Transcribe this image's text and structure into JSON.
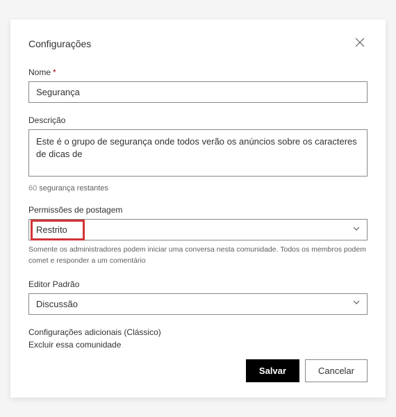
{
  "dialog": {
    "title": "Configurações"
  },
  "fields": {
    "name": {
      "label": "Nome",
      "required_marker": "*",
      "value": "Segurança"
    },
    "description": {
      "label": "Descrição",
      "value": "Este é o grupo de segurança onde todos verão os anúncios sobre os caracteres de dicas de",
      "counter_count": "60",
      "counter_text": "segurança restantes"
    },
    "permissions": {
      "label": "Permissões de postagem",
      "value": "Restrito",
      "helper": "Somente os administradores podem iniciar uma conversa nesta comunidade. Todos os membros podem comet e responder a um comentário"
    },
    "editor": {
      "label": "Editor Padrão",
      "value": "Discussão"
    }
  },
  "links": {
    "additional": "Configurações adicionais (Clássico)",
    "delete": "Excluir essa comunidade"
  },
  "buttons": {
    "save": "Salvar",
    "cancel": "Cancelar"
  }
}
